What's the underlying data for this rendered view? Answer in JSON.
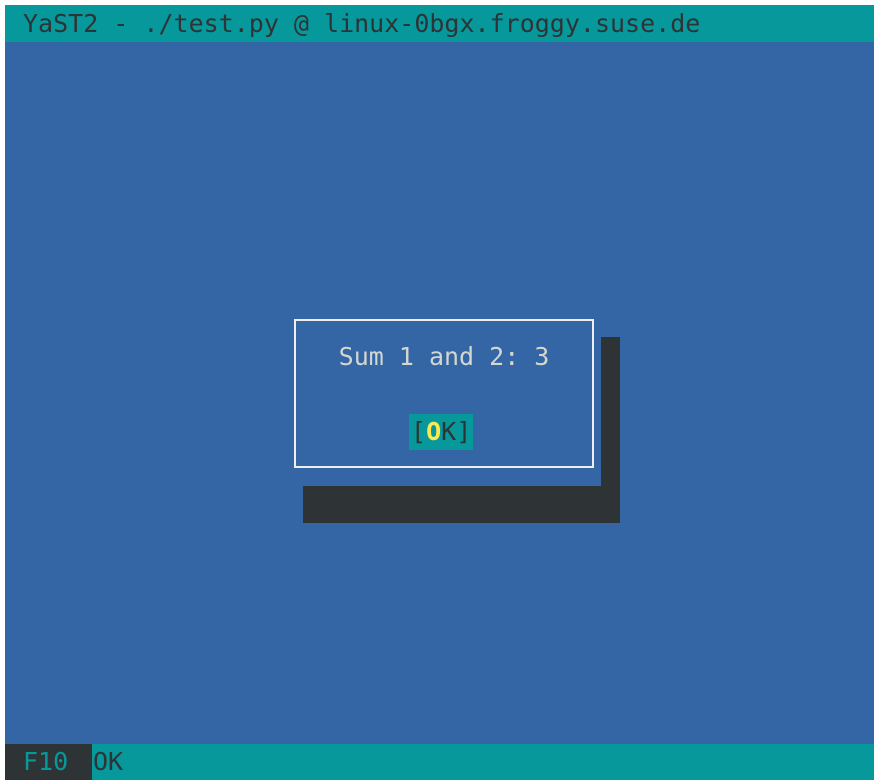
{
  "window": {
    "title": "YaST2 - ./test.py @ linux-0bgx.froggy.suse.de"
  },
  "dialog": {
    "message": "Sum 1 and 2: 3",
    "ok_button": {
      "open_bracket": "[",
      "hotkey": "O",
      "rest": "K",
      "close_bracket": "]"
    }
  },
  "status_bar": {
    "function_key": "F10",
    "function_label": "OK"
  },
  "colors": {
    "background": "#3465a4",
    "accent": "#06989a",
    "shadow": "#2e3436",
    "text": "#d3d7cf",
    "hotkey": "#fce94f"
  }
}
